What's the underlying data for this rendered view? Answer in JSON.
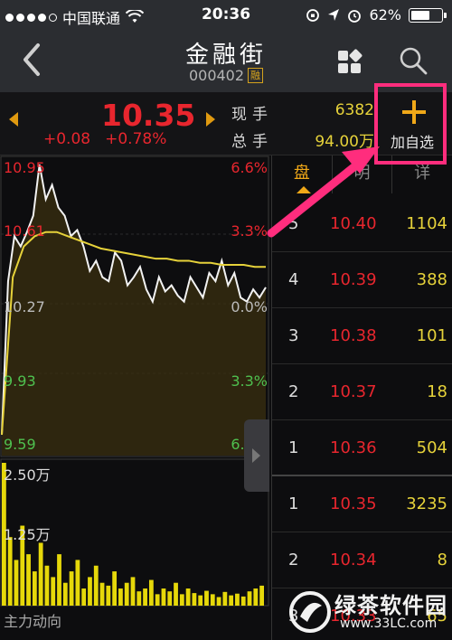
{
  "status_bar": {
    "carrier": "中国联通",
    "time": "20:36",
    "battery": "62%",
    "battery_level": 0.62,
    "signal_dots_filled": 4,
    "icons": [
      "wifi-icon",
      "rotation-lock-icon",
      "location-icon",
      "alarm-icon",
      "battery-icon"
    ]
  },
  "nav": {
    "title": "金融街",
    "code": "000402",
    "badge": "融",
    "icons": [
      "back-chevron-icon",
      "grid-icon",
      "search-icon"
    ]
  },
  "quote": {
    "price": "10.35",
    "change": "+0.08",
    "change_pct": "+0.78%",
    "current_label": "现手",
    "current_value": "6382",
    "total_label": "总手",
    "total_value": "94.00万",
    "add_favorite_label": "加自选",
    "colors": {
      "up": "#e8262e",
      "accent": "#f0a818",
      "highlight": "#ff2d7d"
    }
  },
  "chart": {
    "price_labels_left": [
      "10.95",
      "10.61",
      "10.27",
      "9.93",
      "9.59"
    ],
    "pct_labels_right": [
      "6.6%",
      "3.3%",
      "0.0%",
      "3.3%",
      "6.6%"
    ],
    "volume_labels": [
      "2.50万",
      "1.25万"
    ],
    "footer_label": "主力动向"
  },
  "chart_data": {
    "type": "line",
    "ylim": [
      9.59,
      10.95
    ],
    "series": [
      {
        "values": [
          9.63,
          10.38,
          10.6,
          10.55,
          10.62,
          10.7,
          10.95,
          10.78,
          10.85,
          10.74,
          10.7,
          10.6,
          10.63,
          10.55,
          10.43,
          10.48,
          10.4,
          10.38,
          10.52,
          10.48,
          10.36,
          10.4,
          10.45,
          10.34,
          10.28,
          10.4,
          10.33,
          10.36,
          10.31,
          10.28,
          10.4,
          10.35,
          10.3,
          10.42,
          10.38,
          10.48,
          10.36,
          10.42,
          10.3,
          10.28,
          10.34,
          10.3,
          10.35
        ]
      },
      {
        "values": [
          9.63,
          10.4,
          10.55,
          10.6,
          10.62,
          10.62,
          10.6,
          10.58,
          10.56,
          10.54,
          10.53,
          10.52,
          10.51,
          10.5,
          10.49,
          10.49,
          10.48,
          10.48,
          10.47,
          10.47,
          10.46,
          10.46,
          10.46,
          10.45,
          10.45
        ]
      }
    ],
    "volume": [
      25000,
      12000,
      8000,
      14000,
      9000,
      6000,
      11000,
      7000,
      5000,
      9000,
      4000,
      6000,
      8000,
      3000,
      5000,
      7000,
      4000,
      3500,
      6000,
      3000,
      4000,
      5000,
      2500,
      3000,
      4500,
      2000,
      3000,
      2500,
      4000,
      2000,
      3000,
      2200,
      1800,
      2600,
      2000,
      1500,
      2400,
      1800,
      2100,
      1600,
      2500,
      3000,
      3500
    ]
  },
  "order_book": {
    "tabs": [
      "盘",
      "明",
      "详"
    ],
    "asks": [
      {
        "level": "5",
        "price": "10.40",
        "volume": "1104"
      },
      {
        "level": "4",
        "price": "10.39",
        "volume": "388"
      },
      {
        "level": "3",
        "price": "10.38",
        "volume": "101"
      },
      {
        "level": "2",
        "price": "10.37",
        "volume": "18"
      },
      {
        "level": "1",
        "price": "10.36",
        "volume": "504"
      }
    ],
    "bids": [
      {
        "level": "1",
        "price": "10.35",
        "volume": "3235"
      },
      {
        "level": "2",
        "price": "10.34",
        "volume": "8"
      },
      {
        "level": "3",
        "price": "10.33",
        "volume": "65"
      }
    ]
  },
  "watermark": {
    "text": "绿茶软件园",
    "url": "www.33LC.com"
  }
}
